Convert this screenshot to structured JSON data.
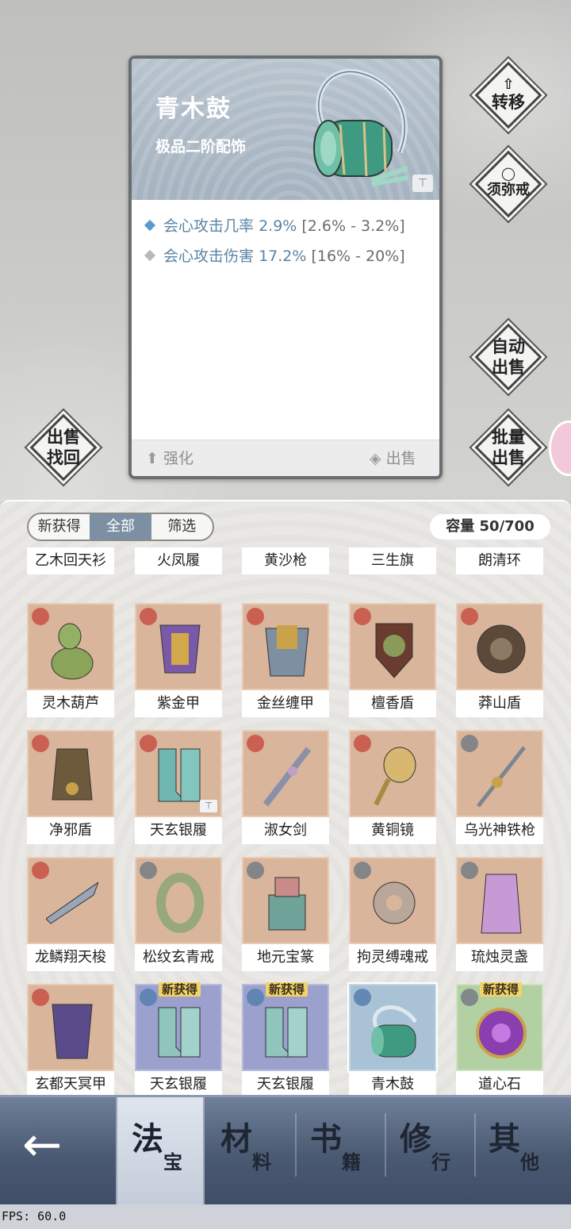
{
  "detail": {
    "name": "青木鼓",
    "grade": "极品二阶配饰",
    "stats": [
      {
        "label": "会心攻击几率",
        "value": "2.9%",
        "range": "[2.6% - 3.2%]",
        "bullet_color": "#5a9ad0"
      },
      {
        "label": "会心攻击伤害",
        "value": "17.2%",
        "range": "[16% - 20%]",
        "bullet_color": "#b8b8b8"
      }
    ],
    "enhance_label": "强化",
    "sell_label": "出售"
  },
  "side_buttons": {
    "transfer": "转移",
    "sumeru_ring": "须弥戒",
    "auto_sell_1": "自动",
    "auto_sell_2": "出售",
    "batch_sell_1": "批量",
    "batch_sell_2": "出售",
    "recover_1": "出售",
    "recover_2": "找回"
  },
  "filter": {
    "tabs": [
      "新获得",
      "全部",
      "筛选"
    ],
    "active_index": 1,
    "capacity": "容量 50/700"
  },
  "items_partial_row": [
    "乙木回天衫",
    "火凤履",
    "黄沙枪",
    "三生旗",
    "朗清环"
  ],
  "items": [
    {
      "name": "灵木葫芦",
      "bg": "orange",
      "new": false
    },
    {
      "name": "紫金甲",
      "bg": "orange",
      "new": false
    },
    {
      "name": "金丝缠甲",
      "bg": "orange",
      "new": false
    },
    {
      "name": "檀香盾",
      "bg": "orange",
      "new": false
    },
    {
      "name": "莽山盾",
      "bg": "orange",
      "new": false
    },
    {
      "name": "净邪盾",
      "bg": "orange",
      "new": false
    },
    {
      "name": "天玄银履",
      "bg": "orange",
      "new": false
    },
    {
      "name": "淑女剑",
      "bg": "orange",
      "new": false
    },
    {
      "name": "黄铜镜",
      "bg": "orange",
      "new": false
    },
    {
      "name": "乌光神铁枪",
      "bg": "orange",
      "new": false
    },
    {
      "name": "龙鳞翔天梭",
      "bg": "orange",
      "new": false
    },
    {
      "name": "松纹玄青戒",
      "bg": "orange",
      "new": false
    },
    {
      "name": "地元宝篆",
      "bg": "orange",
      "new": false
    },
    {
      "name": "拘灵缚魂戒",
      "bg": "orange",
      "new": false
    },
    {
      "name": "琉烛灵盏",
      "bg": "orange",
      "new": false
    },
    {
      "name": "玄都天冥甲",
      "bg": "orange",
      "new": false
    },
    {
      "name": "天玄银履",
      "bg": "purple",
      "new": true
    },
    {
      "name": "天玄银履",
      "bg": "purple",
      "new": true
    },
    {
      "name": "青木鼓",
      "bg": "blue",
      "new": false
    },
    {
      "name": "道心石",
      "bg": "green",
      "new": true
    }
  ],
  "new_tag": "新获得",
  "nav": {
    "tabs": [
      {
        "big": "法",
        "small": "宝"
      },
      {
        "big": "材",
        "small": "料"
      },
      {
        "big": "书",
        "small": "籍"
      },
      {
        "big": "修",
        "small": "行"
      },
      {
        "big": "其",
        "small": "他"
      }
    ],
    "active_index": 0
  },
  "fps": "FPS: 60.0"
}
